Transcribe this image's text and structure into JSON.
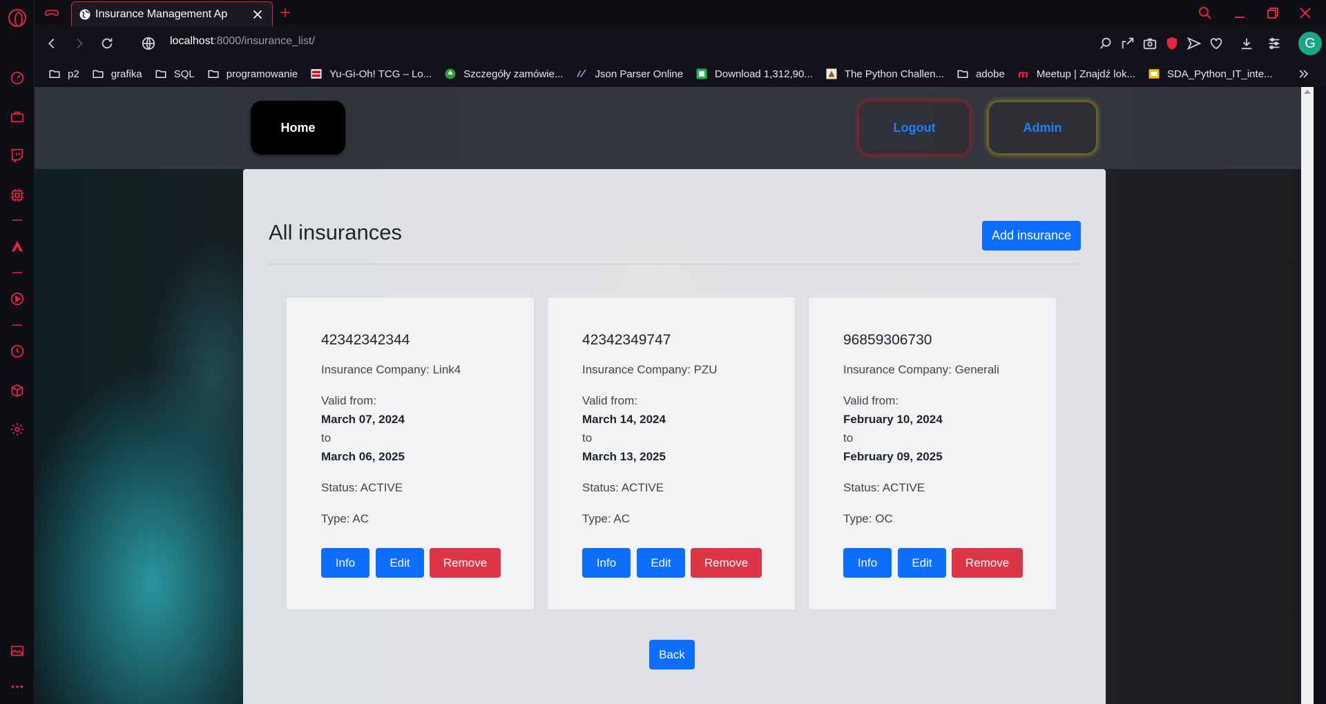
{
  "browser": {
    "tab_title": "Insurance Management Ap",
    "url_host": "localhost",
    "url_path": ":8000/insurance_list/",
    "avatar_letter": "G",
    "accent_color": "#e3263f"
  },
  "bookmarks": [
    {
      "label": "p2",
      "icon": "folder-icon"
    },
    {
      "label": "grafika",
      "icon": "folder-icon"
    },
    {
      "label": "SQL",
      "icon": "folder-icon"
    },
    {
      "label": "programowanie",
      "icon": "folder-icon"
    },
    {
      "label": "Yu-Gi-Oh! TCG – Lo...",
      "icon": "yugioh-favicon"
    },
    {
      "label": "Szczegóły zamówie...",
      "icon": "tree-favicon"
    },
    {
      "label": "Json Parser Online",
      "icon": "json-favicon"
    },
    {
      "label": "Download 1,312,90...",
      "icon": "green-favicon"
    },
    {
      "label": "The Python Challen...",
      "icon": "python-challenge-favicon"
    },
    {
      "label": "adobe",
      "icon": "folder-icon"
    },
    {
      "label": "Meetup | Znajdź lok...",
      "icon": "meetup-favicon"
    },
    {
      "label": "SDA_Python_IT_inte...",
      "icon": "slides-favicon"
    }
  ],
  "navbar": {
    "home": "Home",
    "logout": "Logout",
    "admin": "Admin"
  },
  "page": {
    "title": "All insurances",
    "add_button": "Add insurance",
    "back_button": "Back"
  },
  "labels": {
    "company": "Insurance Company: ",
    "valid_from": "Valid from:",
    "to": "to",
    "status": "Status: ",
    "type": "Type: ",
    "info": "Info",
    "edit": "Edit",
    "remove": "Remove"
  },
  "insurances": [
    {
      "number": "42342342344",
      "company": "Insurance Company: Link4",
      "from": "March 07, 2024",
      "to": "March 06, 2025",
      "status": "Status: ACTIVE",
      "type": "Type: AC"
    },
    {
      "number": "42342349747",
      "company": "Insurance Company: PZU",
      "from": "March 14, 2024",
      "to": "March 13, 2025",
      "status": "Status: ACTIVE",
      "type": "Type: AC"
    },
    {
      "number": "96859306730",
      "company": "Insurance Company: Generali",
      "from": "February 10, 2024",
      "to": "February 09, 2025",
      "status": "Status: ACTIVE",
      "type": "Type: OC"
    }
  ]
}
